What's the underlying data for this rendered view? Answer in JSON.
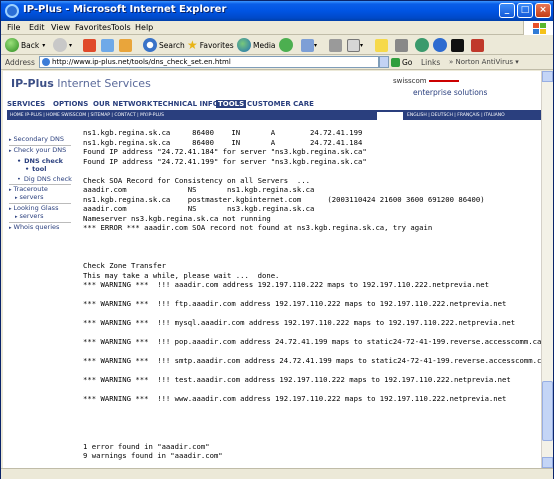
{
  "window": {
    "title": "IP-Plus - Microsoft Internet Explorer",
    "min": "_",
    "max": "□",
    "close": "×"
  },
  "menu": [
    "File",
    "Edit",
    "View",
    "Favorites",
    "Tools",
    "Help"
  ],
  "toolbar": {
    "back": "Back",
    "search": "Search",
    "favorites": "Favorites",
    "media": "Media"
  },
  "address": {
    "label": "Address",
    "url": "http://www.ip-plus.net/tools/dns_check_set.en.html",
    "go": "Go",
    "links": "Links",
    "antivirus": "Norton AntiVirus"
  },
  "site": {
    "brand_bold": "IP-Plus",
    "brand_rest": " Internet Services",
    "swisscom": "swisscom",
    "enterprise": "enterprise solutions",
    "main_nav": [
      "SERVICES",
      "OPTIONS",
      "OUR NETWORK",
      "TECHNICAL INFO",
      "TOOLS",
      "CUSTOMER CARE"
    ],
    "sub_nav": "HOME IP-PLUS  |  HOME SWISSCOM  |  SITEMAP  |  CONTACT  |  MY.IP-PLUS",
    "lang_nav": "ENGLISH  |  DEUTSCH  |  FRANÇAIS  |  ITALIANO"
  },
  "sidebar": {
    "secondary_dns": "Secondary DNS",
    "check_dns_1": "Check your DNS",
    "check_dns_2": "tool",
    "dns_check_tool_1": "DNS check",
    "dns_check_tool_2": "tool",
    "dig_dns": "Dig DNS check",
    "traceroute_1": "Traceroute",
    "traceroute_2": "servers",
    "looking_glass_1": "Looking Glass",
    "looking_glass_2": "servers",
    "whois": "Whois queries"
  },
  "output": [
    "ns1.kgb.regina.sk.ca     86400    IN       A        24.72.41.199",
    "ns1.kgb.regina.sk.ca     86400    IN       A        24.72.41.184",
    "Found IP address \"24.72.41.184\" for server \"ns3.kgb.regina.sk.ca\"",
    "Found IP address \"24.72.41.199\" for server \"ns3.kgb.regina.sk.ca\"",
    "",
    "Check SOA Record for Consistency on all Servers  ...",
    "aaadir.com              NS       ns1.kgb.regina.sk.ca",
    "ns1.kgb.regina.sk.ca    postmaster.kgbinternet.com      (2003110424 21600 3600 691200 86400)",
    "aaadir.com              NS       ns3.kgb.regina.sk.ca",
    "Nameserver ns3.kgb.regina.sk.ca not running",
    "*** ERROR *** aaadir.com SOA record not found at ns3.kgb.regina.sk.ca, try again",
    "",
    "",
    "",
    "Check Zone Transfer",
    "This may take a while, please wait ...  done.",
    "*** WARNING ***  !!! aaadir.com address 192.197.110.222 maps to 192.197.110.222.netprevia.net",
    "",
    "*** WARNING ***  !!! ftp.aaadir.com address 192.197.110.222 maps to 192.197.110.222.netprevia.net",
    "",
    "*** WARNING ***  !!! mysql.aaadir.com address 192.197.110.222 maps to 192.197.110.222.netprevia.net",
    "",
    "*** WARNING ***  !!! pop.aaadir.com address 24.72.41.199 maps to static24-72-41-199.reverse.accesscomm.ca",
    "",
    "*** WARNING ***  !!! smtp.aaadir.com address 24.72.41.199 maps to static24-72-41-199.reverse.accesscomm.ca",
    "",
    "*** WARNING ***  !!! test.aaadir.com address 192.197.110.222 maps to 192.197.110.222.netprevia.net",
    "",
    "*** WARNING ***  !!! www.aaadir.com address 192.197.110.222 maps to 192.197.110.222.netprevia.net",
    "",
    "",
    "",
    "",
    "1 error found in \"aaadir.com\"",
    "9 warnings found in \"aaadir.com\""
  ]
}
